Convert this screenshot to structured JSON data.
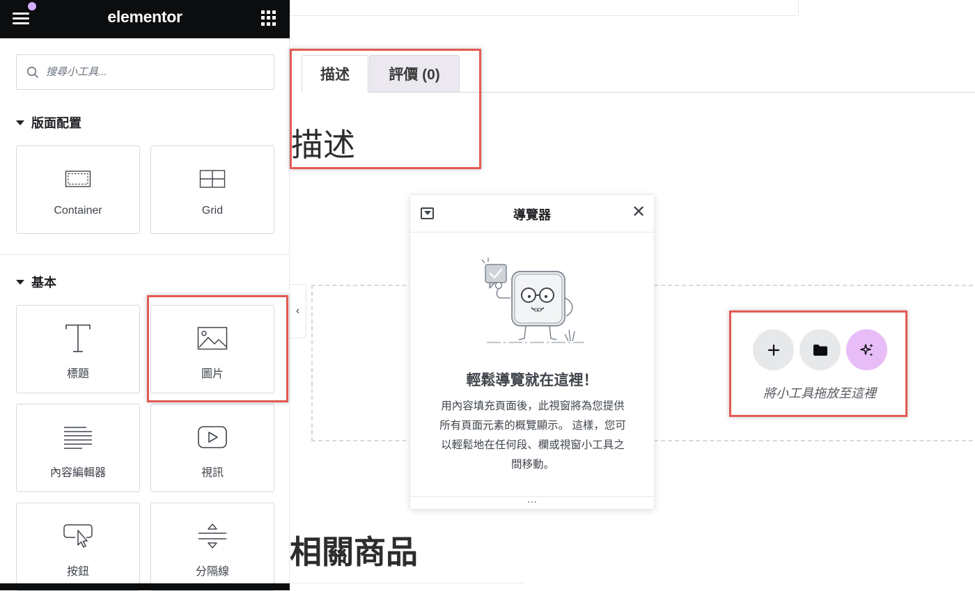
{
  "panel": {
    "logo": "elementor",
    "search": {
      "placeholder": "搜尋小工具...",
      "value": ""
    },
    "categories": [
      {
        "title": "版面配置"
      },
      {
        "title": "基本"
      }
    ],
    "widgets": [
      {
        "label": "Container",
        "icon": "container-icon"
      },
      {
        "label": "Grid",
        "icon": "grid-icon"
      },
      {
        "label": "標題",
        "icon": "heading-icon"
      },
      {
        "label": "圖片",
        "icon": "image-icon"
      },
      {
        "label": "內容編輯器",
        "icon": "text-editor-icon"
      },
      {
        "label": "視訊",
        "icon": "video-icon"
      },
      {
        "label": "按鈕",
        "icon": "button-icon"
      },
      {
        "label": "分隔線",
        "icon": "divider-icon"
      }
    ],
    "collapse_glyph": "‹"
  },
  "canvas": {
    "tabs": [
      {
        "label": "描述"
      },
      {
        "label": "評價 (0)"
      }
    ],
    "section_title": "描述",
    "related_title": "相關商品",
    "dropzone": {
      "text": "將小工具拖放至這裡",
      "add_glyph": "+",
      "ai_glyph": "✦"
    }
  },
  "navigator": {
    "title": "導覽器",
    "close_glyph": "✕",
    "heading": "輕鬆導覽就在這裡！",
    "body": "用內容填充頁面後，此視窗將為您提供所有頁面元素的概覽顯示。 這樣，您可以輕鬆地在任何段、欄或視窗小工具之間移動。",
    "footer_glyph": "···"
  },
  "colors": {
    "topbar": "#0c0d0e",
    "accent_dot": "#d5adfb",
    "highlight": "#e45a54",
    "ai_button": "#e8bdf7",
    "review_tab": "#ece8f0"
  }
}
